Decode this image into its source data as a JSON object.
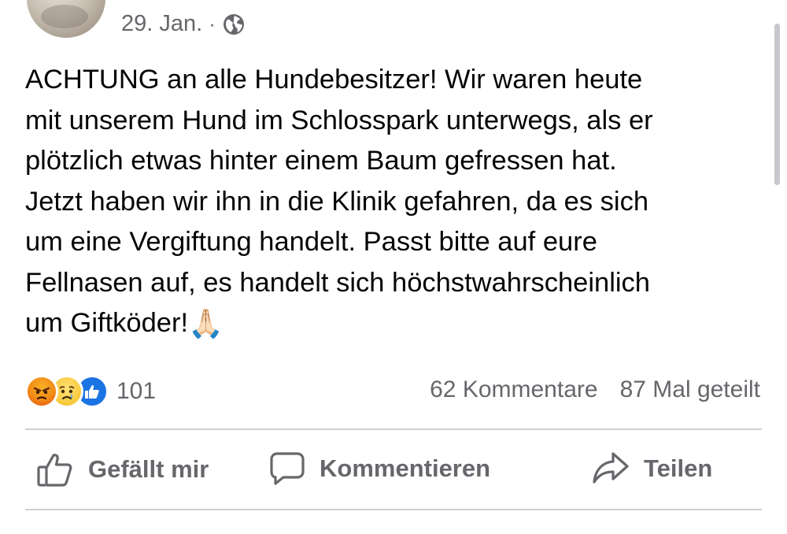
{
  "post": {
    "date": "29. Jan.",
    "separator": "·",
    "audience_icon": "globe-icon",
    "text": "ACHTUNG an alle Hundebesitzer! Wir waren heute\nmit unserem Hund im Schlosspark unterwegs, als er\nplötzlich etwas hinter einem Baum gefressen hat.\nJetzt haben wir ihn in die Klinik gefahren, da es sich\num eine Vergiftung handelt. Passt bitte auf eure\nFellnasen auf, es handelt sich höchstwahrscheinlich\num Giftköder!",
    "text_emoji": "🙏🏻"
  },
  "engagement": {
    "reaction_icons": [
      "angry-react-icon",
      "sad-react-icon",
      "like-react-icon"
    ],
    "reaction_count": "101",
    "comments": "62 Kommentare",
    "shares": "87 Mal geteilt"
  },
  "actions": {
    "like_label": "Gefällt mir",
    "comment_label": "Kommentieren",
    "share_label": "Teilen"
  },
  "colors": {
    "text": "#050505",
    "secondary_text": "#65676b",
    "divider": "#ced0d4",
    "like_blue": "#1b74e4"
  }
}
